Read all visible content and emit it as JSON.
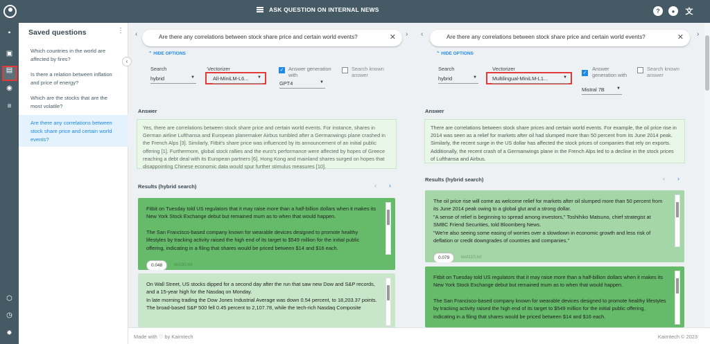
{
  "header": {
    "title": "ASK QUESTION ON INTERNAL NEWS"
  },
  "sidebar": {
    "title": "Saved questions",
    "items": [
      {
        "label": "Which countries in the world are affected by fires?"
      },
      {
        "label": "Is there a relation between inflation and price of energy?"
      },
      {
        "label": "Which are the stocks that are the most volatile?"
      },
      {
        "label": "Are there any correlations between stock share price and certain world events?"
      }
    ]
  },
  "left": {
    "query": "Are there any correlations between stock share price and certain world events?",
    "hide_options": "HIDE OPTIONS",
    "search_label": "Search",
    "search_value": "hybrid",
    "vectorizer_label": "Vectorizer",
    "vectorizer_value": "All-MiniLM-L6...",
    "answer_gen_label": "Answer generation with",
    "answer_gen_value": "GPT4",
    "search_known_label": "Search known answer",
    "answer_heading": "Answer",
    "answer_text": "Yes, there are correlations between stock share price and certain world events. For instance, shares in German airline Lufthansa and European planemaker Airbus tumbled after a Germanwings plane crashed in the French Alps [3]. Similarly, Fitbit's share price was influenced by its announcement of an initial public offering [1]. Furthermore, global stock rallies and the euro's performance were affected by hopes of Greece reaching a debt deal with its European partners [6]. Hong Kong and mainland shares surged on hopes that disappointing Chinese economic data would spur further stimulus measures [10].",
    "results_heading": "Results (hybrid search)",
    "cards": [
      {
        "p1": "Fitbit on Tuesday told US regulators that it may raise more than a half-billion dollars when it makes its New York Stock Exchange debut but remained mum as to when that would happen.",
        "p2": "The San Francisco-based company known for wearable devices designed to promote healthy lifestyles by tracking activity raised the high end of its target to $549 million for the initial public offering, indicating in a filing that shares would be priced between $14 and $16 each.",
        "score": "0.048",
        "file": "text30.txt"
      },
      {
        "p1": "On Wall Street, US stocks dipped for a second day after the run that saw new Dow and S&P records, and a 15-year high for the Nasdaq on Monday.",
        "p2": "In late morning trading the Dow Jones Industrial Average was down 0.54 percent, to 18,203.37 points.",
        "p3": "The broad-based S&P 500 fell 0.45 percent to 2,107.78, while the tech-rich Nasdaq Composite"
      }
    ]
  },
  "right": {
    "query": "Are there any correlations between stock share price and certain world events?",
    "hide_options": "HIDE OPTIONS",
    "search_label": "Search",
    "search_value": "hybrid",
    "vectorizer_label": "Vectorizer",
    "vectorizer_value": "Multilingual-MiniLM-L1...",
    "answer_gen_label": "Answer generation with",
    "answer_gen_value": "Mistral 7B",
    "search_known_label": "Search known answer",
    "answer_heading": "Answer",
    "answer_text": "There are correlations between stock share prices and certain world events. For example, the oil price rise in 2014 was seen as a relief for markets after oil had slumped more than 50 percent from its June 2014 peak. Similarly, the recent surge in the US dollar has affected the stock prices of companies that rely on exports. Additionally, the recent crash of a Germanwings plane in the French Alps led to a decline in the stock prices of Lufthansa and Airbus.",
    "results_heading": "Results (hybrid search)",
    "cards": [
      {
        "p1": "The oil price rise will come as welcome relief for markets after oil slumped more than 50 percent from its June 2014 peak owing to a global glut and a strong dollar.",
        "p2": "\"A sense of relief is beginning to spread among investors,\" Toshihiko Matsuno, chief strategist at SMBC Friend Securities, told Bloomberg News.",
        "p3": "\"We're also seeing some easing of worries over a slowdown in economic growth and less risk of deflation or credit downgrades of countries and companies.\"",
        "score": "0.079",
        "file": "text110.txt"
      },
      {
        "p1": "Fitbit on Tuesday told US regulators that it may raise more than a half-billion dollars when it makes its New York Stock Exchange debut but remained mum as to when that would happen.",
        "p2": "The San Francisco-based company known for wearable devices designed to promote healthy lifestyles by tracking activity raised the high end of its target to $549 million for the initial public offering, indicating in a filing that shares would be priced between $14 and $16 each."
      }
    ]
  },
  "footer": {
    "left": "Made with ♡ by Kairntech",
    "right": "Kairntech © 2023"
  }
}
